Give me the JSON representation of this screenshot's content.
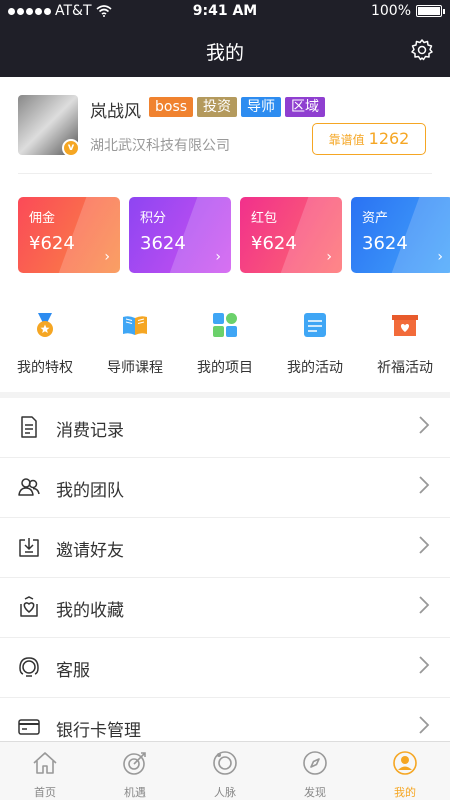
{
  "status_bar": {
    "carrier": "AT&T",
    "time": "9:41 AM",
    "battery": "100%"
  },
  "nav": {
    "title": "我的"
  },
  "profile": {
    "name": "岚战风",
    "tags": [
      {
        "label": "boss",
        "color": "#f0822f"
      },
      {
        "label": "投资",
        "color": "#b49a5d"
      },
      {
        "label": "导师",
        "color": "#2d8cf0"
      },
      {
        "label": "区域",
        "color": "#8f3fd0"
      }
    ],
    "company": "湖北武汉科技有限公司",
    "rating_label": "靠谱值",
    "rating_value": "1262",
    "badge": "v"
  },
  "cards": [
    {
      "title": "佣金",
      "value": "¥624",
      "from": "#fb4a58",
      "to": "#f98b42"
    },
    {
      "title": "积分",
      "value": "3624",
      "from": "#8e45f2",
      "to": "#cf52f0"
    },
    {
      "title": "红包",
      "value": "¥624",
      "from": "#f1308c",
      "to": "#ff6d6d"
    },
    {
      "title": "资产",
      "value": "3624",
      "from": "#2a72f3",
      "to": "#44a6fb"
    }
  ],
  "features": [
    {
      "label": "我的特权",
      "icon": "medal-icon"
    },
    {
      "label": "导师课程",
      "icon": "book-icon"
    },
    {
      "label": "我的项目",
      "icon": "grid-icon"
    },
    {
      "label": "我的活动",
      "icon": "calendar-icon"
    },
    {
      "label": "祈福活动",
      "icon": "gift-box-icon"
    }
  ],
  "menu": [
    {
      "label": "消费记录",
      "icon": "receipt-icon"
    },
    {
      "label": "我的团队",
      "icon": "team-icon"
    },
    {
      "label": "邀请好友",
      "icon": "invite-icon"
    },
    {
      "label": "我的收藏",
      "icon": "favorite-icon"
    },
    {
      "label": "客服",
      "icon": "headset-icon"
    },
    {
      "label": "银行卡管理",
      "icon": "bank-card-icon"
    }
  ],
  "tabs": [
    {
      "label": "首页",
      "icon": "home-icon"
    },
    {
      "label": "机遇",
      "icon": "target-icon"
    },
    {
      "label": "人脉",
      "icon": "network-icon"
    },
    {
      "label": "发现",
      "icon": "compass-icon"
    },
    {
      "label": "我的",
      "icon": "person-icon",
      "active": true
    }
  ],
  "colors": {
    "accent": "#f5a623",
    "header_bg": "#1f1f28"
  }
}
